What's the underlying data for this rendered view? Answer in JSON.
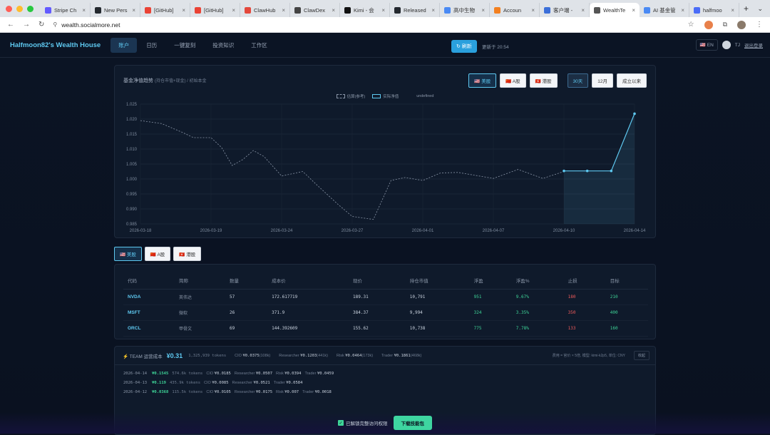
{
  "browser": {
    "tabs": [
      {
        "label": "Stripe Ch",
        "color": "#635bff"
      },
      {
        "label": "New Pers",
        "color": "#24292f"
      },
      {
        "label": "[GitHub]",
        "color": "#ea4335"
      },
      {
        "label": "[GitHub]",
        "color": "#ea4335"
      },
      {
        "label": "ClawHub",
        "color": "#e4483c"
      },
      {
        "label": "ClawDex",
        "color": "#444444"
      },
      {
        "label": "Kimi - 会",
        "color": "#111111"
      },
      {
        "label": "Released",
        "color": "#24292f"
      },
      {
        "label": "高中生物",
        "color": "#4a8af4"
      },
      {
        "label": "Accoun",
        "color": "#f38020"
      },
      {
        "label": "客户端 -",
        "color": "#3b6fd9"
      },
      {
        "label": "WealthTe",
        "color": "#555555",
        "active": true
      },
      {
        "label": "AI 基金管",
        "color": "#4a8af4"
      },
      {
        "label": "halfmoo",
        "color": "#4a6cf7"
      }
    ],
    "new_tab": "+",
    "url": "wealth.socialmore.net"
  },
  "nav": {
    "brand": "Halfmoon82's Wealth House",
    "links": [
      "账户",
      "日历",
      "一键复刻",
      "投资知识",
      "工作区"
    ],
    "refresh_label": "↻ 刷新",
    "updated": "更新于 20:54",
    "lang": "🇺🇸 EN",
    "user": "TJ",
    "logout": "退出登录"
  },
  "chart": {
    "title": "基金净值趋势",
    "subtitle": "(持仓市值+现金) / 初始本金",
    "market_buttons": [
      "🇺🇸 美股",
      "🇨🇳 A股",
      "🇭🇰 港股"
    ],
    "range_buttons": [
      "30天",
      "12月",
      "成立以来"
    ],
    "legend": [
      "估算(参考)",
      "实际净值",
      "undefined"
    ]
  },
  "chart_data": {
    "type": "line",
    "x_ticks": [
      "2026-03-18",
      "2026-03-19",
      "2026-03-24",
      "2026-03-27",
      "2026-04-01",
      "2026-04-07",
      "2026-04-10",
      "2026-04-14"
    ],
    "ylim": [
      0.985,
      1.025
    ],
    "y_ticks": [
      0.985,
      0.99,
      0.995,
      1.0,
      1.005,
      1.01,
      1.015,
      1.02,
      1.025
    ],
    "series": [
      {
        "name": "估算(参考)",
        "style": "dashed",
        "color": "#8a96a8",
        "points": [
          [
            0,
            1.0195
          ],
          [
            0.3,
            1.0185
          ],
          [
            0.6,
            1.0155
          ],
          [
            0.75,
            1.0138
          ],
          [
            1.0,
            1.0138
          ],
          [
            1.15,
            1.0105
          ],
          [
            1.3,
            1.0045
          ],
          [
            1.45,
            1.0065
          ],
          [
            1.6,
            1.0095
          ],
          [
            1.75,
            1.0075
          ],
          [
            2.0,
            1.001
          ],
          [
            2.3,
            1.0025
          ],
          [
            2.5,
            0.998
          ],
          [
            2.8,
            0.9915
          ],
          [
            3.0,
            0.9875
          ],
          [
            3.3,
            0.9865
          ],
          [
            3.55,
            0.9995
          ],
          [
            3.75,
            1.0005
          ],
          [
            4.0,
            0.9995
          ],
          [
            4.25,
            1.002
          ],
          [
            4.5,
            1.0022
          ],
          [
            5.0,
            1.0002
          ],
          [
            5.35,
            1.0032
          ],
          [
            5.7,
            1.0002
          ],
          [
            6.0,
            1.0025
          ]
        ]
      },
      {
        "name": "实际净值",
        "style": "solid",
        "color": "#5ec8f0",
        "points": [
          [
            6.0,
            1.0027
          ],
          [
            6.33,
            1.0027
          ],
          [
            6.67,
            1.0027
          ],
          [
            7.0,
            1.0218
          ]
        ]
      }
    ]
  },
  "market_tabs": [
    "🇺🇸 美股",
    "🇨🇳 A股",
    "🇭🇰 港股"
  ],
  "holdings": {
    "headers": [
      "代码",
      "简称",
      "数量",
      "成本价",
      "现价",
      "持仓市值",
      "浮盈",
      "浮盈%",
      "止损",
      "目标"
    ],
    "rows": [
      [
        "NVDA",
        "英伟达",
        "57",
        "172.617719",
        "189.31",
        "10,791",
        "951",
        "9.67%",
        "180",
        "210"
      ],
      [
        "MSFT",
        "微软",
        "26",
        "371.9",
        "384.37",
        "9,994",
        "324",
        "3.35%",
        "350",
        "400"
      ],
      [
        "ORCL",
        "甲骨文",
        "69",
        "144.392609",
        "155.62",
        "10,738",
        "775",
        "7.78%",
        "133",
        "160"
      ]
    ]
  },
  "cost": {
    "label": "⚡ TEAM 运营成本",
    "total": "¥0.31",
    "tokens": "1,325,939 tokens",
    "items": [
      {
        "k": "CIO",
        "v": "¥0.0375",
        "t": "(108k)"
      },
      {
        "k": "Researcher",
        "v": "¥0.1203",
        "t": "(441k)"
      },
      {
        "k": "Risk",
        "v": "¥0.0464",
        "t": "(173k)"
      },
      {
        "k": "Trader",
        "v": "¥0.1861",
        "t": "(468k)"
      }
    ],
    "note": "费用 = 官价 × 5倍, 模型: kimi-k2p5, 单位: CNY",
    "collapse": "收起",
    "rows": [
      {
        "date": "2026-04-14",
        "amt": "¥0.1545",
        "tok": "574.6k tokens",
        "parts": [
          [
            "CIO",
            "¥0.0185"
          ],
          [
            "Researcher",
            "¥0.0507"
          ],
          [
            "Risk",
            "¥0.0394"
          ],
          [
            "Trader",
            "¥0.0459"
          ]
        ]
      },
      {
        "date": "2026-04-13",
        "amt": "¥0.119",
        "tok": "435.9k tokens",
        "parts": [
          [
            "CIO",
            "¥0.0085"
          ],
          [
            "Researcher",
            "¥0.0521"
          ],
          [
            "Trader",
            "¥0.0584"
          ]
        ]
      },
      {
        "date": "2026-04-12",
        "amt": "¥0.0368",
        "tok": "115.5k tokens",
        "parts": [
          [
            "CIO",
            "¥0.0105"
          ],
          [
            "Researcher",
            "¥0.0175"
          ],
          [
            "Risk",
            "¥0.007"
          ],
          [
            "Trader",
            "¥0.0018"
          ]
        ]
      }
    ]
  },
  "footer": {
    "unlock": "已解锁完整访问权限",
    "download": "下载技能包"
  }
}
